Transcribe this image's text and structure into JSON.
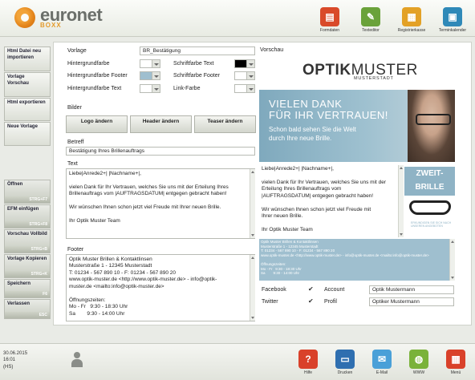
{
  "header": {
    "brand": "euronet",
    "brand_sub": "BOXX",
    "tools": [
      {
        "label": "Formdaten",
        "icon": "formdata-icon",
        "color": "#d94a2a"
      },
      {
        "label": "Texteditor",
        "icon": "pencil-icon",
        "color": "#6aa23a"
      },
      {
        "label": "Registrierkasse",
        "icon": "cash-register-icon",
        "color": "#e3a126"
      },
      {
        "label": "Terminkalender",
        "icon": "calendar-icon",
        "color": "#2f89b8"
      }
    ]
  },
  "sidebar": {
    "top_items": [
      {
        "label": "Html Datei neu importieren"
      },
      {
        "label": "Vorlage Vorschau"
      },
      {
        "label": "Html exportieren"
      },
      {
        "label": "Neue Vorlage"
      }
    ],
    "bottom_items": [
      {
        "label": "Öffnen",
        "key": "STRG+F7"
      },
      {
        "label": "EFM einfügen",
        "key": "STRG+F8"
      },
      {
        "label": "Vorschau Vollbild",
        "key": "STRG+B"
      },
      {
        "label": "Vorlage Kopieren",
        "key": "STRG+K"
      },
      {
        "label": "Speichern",
        "key": "F6"
      },
      {
        "label": "Verlassen",
        "key": "ESC"
      }
    ]
  },
  "form": {
    "vorlage_label": "Vorlage",
    "vorlage_value": "BR_Bestätigung",
    "hintergrundfarbe_label": "Hintergrundfarbe",
    "hintergrundfarbe_footer_label": "Hintergrundfarbe Footer",
    "hintergrundfarbe_text_label": "Hintergrundfarbe Text",
    "schriftfarbe_text_label": "Schriftfarbe Text",
    "schriftfarbe_footer_label": "Schriftfarbe Footer",
    "link_farbe_label": "Link-Farbe",
    "colors": {
      "hintergrundfarbe": "#ffffff",
      "hintergrundfarbe_footer": "#9fbfcf",
      "hintergrundfarbe_text": "#ffffff",
      "schriftfarbe_text": "#000000",
      "schriftfarbe_footer": "#ffffff",
      "link_farbe": "#ffffff"
    },
    "bilder_label": "Bilder",
    "logo_button": "Logo ändern",
    "header_button": "Header ändern",
    "teaser_button": "Teaser ändern",
    "betreff_label": "Betreff",
    "betreff_value": "Bestätigung Ihres Brillenauftrags",
    "text_label": "Text",
    "text_value": "Liebe|Anrede2+| |Nachname+|,\n\nvielen Dank für Ihr Vertrauen, welches Sie uns mit der Erteilung Ihres\nBrillenauftrags vom |AUFTRAGSDATUM| entgegen gebracht haben!\n\nWir wünschen Ihnen schon jetzt viel Freude mit Ihrer neuen Brille.\n\nIhr Optik Muster Team",
    "footer_label": "Footer",
    "footer_value": "Optik Muster Brillen & Kontaktlinsen\nMusterstraße 1 - 12345 Musterstadt\nT: 01234 - 567 890 10 - F: 01234 - 567 890 20\nwww.optik-muster.de <http://www.optik-muster.de> - info@optik-\nmuster.de <mailto:info@optik-muster.de>\n\nÖffnungszeiten:\nMo - Fr   9:30 - 18:30 Uhr\nSa        9:30 - 14:00 Uhr"
  },
  "preview": {
    "title": "Vorschau",
    "logo_main": "OPTIK",
    "logo_rest": "MUSTER",
    "logo_sub": "MUSTERSTADT",
    "banner_line1": "VIELEN DANK",
    "banner_line2": "FÜR IHR VERTRAUEN!",
    "banner_line3": "Schon bald sehen Sie die Welt",
    "banner_line4": "durch Ihre neue Brille.",
    "body_text": "Liebe|Anrede2+| |Nachname+|,\n\nvielen Dank für Ihr Vertrauen, welches Sie uns mit der\nErteilung Ihres Brillenauftrags vom\n|AUFTRAGSDATUM| entgegen gebracht haben!\n\nWir wünschen Ihnen schon jetzt viel Freude mit\nIhrer neuen Brille.\n\nIhr Optik Muster Team",
    "teaser_line1": "ZWEIT-",
    "teaser_line2": "BRILLE",
    "teaser_small": "ERKUNDIGEN SIE SICH NACH UNSEREN ANGEBOTEN",
    "footer_text": "Optik Muster Brillen & Kontaktlinsen\nMusterstraße 1 - 12345 Musterstadt\nT: 01234 - 567 890 10 - F: 01234 - 567 890 20\nwww.optik-muster.de <http://www.optik-muster.de> - info@optik-muster.de <mailto:info@optik-muster.de>\n\nÖffnungszeiten:\nMo - Fr   9:30 - 18:30 Uhr\nSa        9:30 - 14:00 Uhr"
  },
  "social": {
    "facebook_label": "Facebook",
    "twitter_label": "Twitter",
    "account_label": "Account",
    "profil_label": "Profil",
    "account_value": "Optik Mustermann",
    "profil_value": "Optiker Mustermann"
  },
  "footer_bar": {
    "date": "30.06.2015",
    "time": "16:01",
    "mode": "(HS)",
    "tools": [
      {
        "label": "Hilfe",
        "icon": "help-icon",
        "color": "#d9412a"
      },
      {
        "label": "Drucken",
        "icon": "printer-icon",
        "color": "#2f6fb0"
      },
      {
        "label": "E-Mail",
        "icon": "email-icon",
        "color": "#4aa0d8"
      },
      {
        "label": "WWW",
        "icon": "globe-icon",
        "color": "#7ab23a"
      },
      {
        "label": "Menü",
        "icon": "menu-icon",
        "color": "#d9412a"
      }
    ]
  }
}
